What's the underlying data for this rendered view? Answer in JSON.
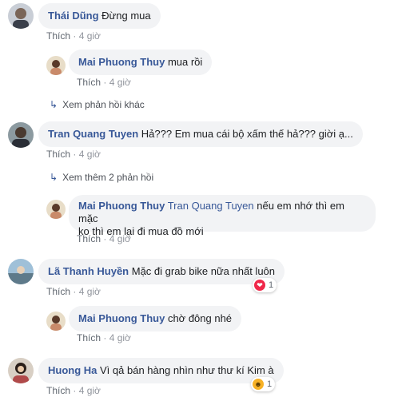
{
  "comments": [
    {
      "name": "Thái Dũng",
      "text": "Đừng mua",
      "like": "Thích",
      "time": "4 giờ"
    },
    {
      "name": "Mai Phuong Thuy",
      "text": "mua rồi",
      "like": "Thích",
      "time": "4 giờ"
    },
    {
      "name": "Tran Quang Tuyen",
      "text": "Hả??? Em mua cái bộ xấm thế hả??? giời ạ...",
      "like": "Thích",
      "time": "4 giờ"
    },
    {
      "name": "Mai Phuong Thuy",
      "tag": "Tran Quang Tuyen",
      "text_line1": " nếu em nhớ thì em mặc",
      "text_line2": "ko thì em lại đi mua đồ mới",
      "like": "Thích",
      "time": "4 giờ"
    },
    {
      "name": "Lã Thanh Huyền",
      "text": "Mặc đi grab bike nữa nhất luôn",
      "like": "Thích",
      "time": "4 giờ",
      "reaction_count": "1"
    },
    {
      "name": "Mai Phuong Thuy",
      "text": "chờ đông nhé",
      "like": "Thích",
      "time": "4 giờ"
    },
    {
      "name": "Huong Ha",
      "text": "Vì qả bán hàng nhìn như thư kí Kim à",
      "like": "Thích",
      "time": "4 giờ",
      "reaction_count": "1"
    }
  ],
  "reply_links": {
    "more_replies": "Xem phản hồi khác",
    "two_more": "Xem thêm 2 phản hồi"
  },
  "separator": " · ",
  "icons": {
    "reply_arrow": "reply-arrow-icon",
    "love": "love-reaction-icon",
    "haha": "haha-reaction-icon"
  }
}
